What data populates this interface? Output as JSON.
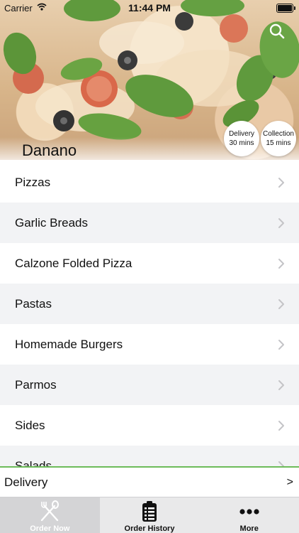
{
  "status_bar": {
    "carrier": "Carrier",
    "time": "11:44 PM"
  },
  "restaurant": {
    "name": "Danano"
  },
  "badges": {
    "delivery": {
      "title": "Delivery",
      "time": "30 mins"
    },
    "collection": {
      "title": "Collection",
      "time": "15 mins"
    }
  },
  "menu": {
    "items": [
      {
        "label": "Pizzas"
      },
      {
        "label": "Garlic Breads"
      },
      {
        "label": "Calzone Folded Pizza"
      },
      {
        "label": "Pastas"
      },
      {
        "label": "Homemade Burgers"
      },
      {
        "label": "Parmos"
      },
      {
        "label": "Sides"
      },
      {
        "label": "Salads"
      }
    ]
  },
  "delivery_bar": {
    "label": "Delivery",
    "arrow": ">"
  },
  "tab_bar": {
    "tabs": [
      {
        "label": "Order Now",
        "icon": "fork-knife-icon",
        "active": true
      },
      {
        "label": "Order History",
        "icon": "clipboard-list-icon",
        "active": false
      },
      {
        "label": "More",
        "icon": "more-dots-icon",
        "active": false
      }
    ]
  },
  "colors": {
    "accent_green": "#6dbb5a",
    "row_alt": "#f2f3f5",
    "tab_bar_bg": "#e9e9ea"
  }
}
